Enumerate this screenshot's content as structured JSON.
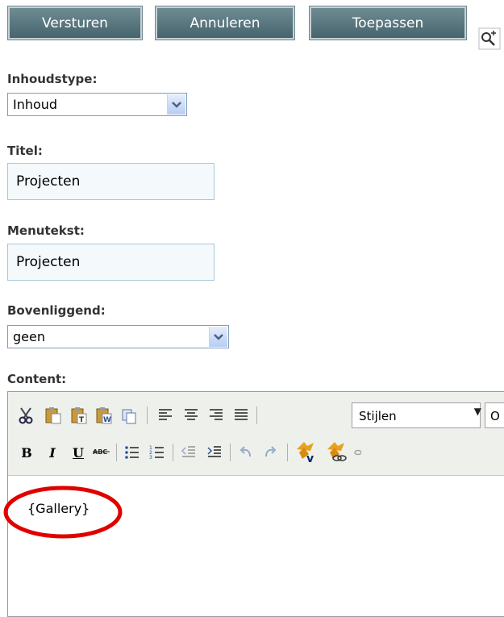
{
  "toolbar_buttons": {
    "submit": "Versturen",
    "cancel": "Annuleren",
    "apply": "Toepassen"
  },
  "fields": {
    "content_type": {
      "label": "Inhoudstype:",
      "value": "Inhoud"
    },
    "title": {
      "label": "Titel:",
      "value": "Projecten"
    },
    "menu_text": {
      "label": "Menutekst:",
      "value": "Projecten"
    },
    "parent": {
      "label": "Bovenliggend:",
      "value": "geen"
    },
    "content": {
      "label": "Content:"
    }
  },
  "editor": {
    "styles_value": "Stijlen",
    "font_value": "O",
    "body_text": "{Gallery}",
    "icons_row1": [
      "cut-icon",
      "paste-icon",
      "paste-text-icon",
      "paste-word-icon",
      "copy-icon",
      "align-left-icon",
      "align-center-icon",
      "align-right-icon",
      "justify-icon"
    ],
    "icons_row2": [
      "bold-icon",
      "italic-icon",
      "underline-icon",
      "spellcheck-icon",
      "bullet-list-icon",
      "numbered-list-icon",
      "outdent-icon",
      "indent-icon",
      "undo-icon",
      "redo-icon",
      "insert-v-icon",
      "insert-link-icon"
    ]
  },
  "colors": {
    "button_bg": "#5a7780",
    "highlight_circle": "#e00000"
  }
}
